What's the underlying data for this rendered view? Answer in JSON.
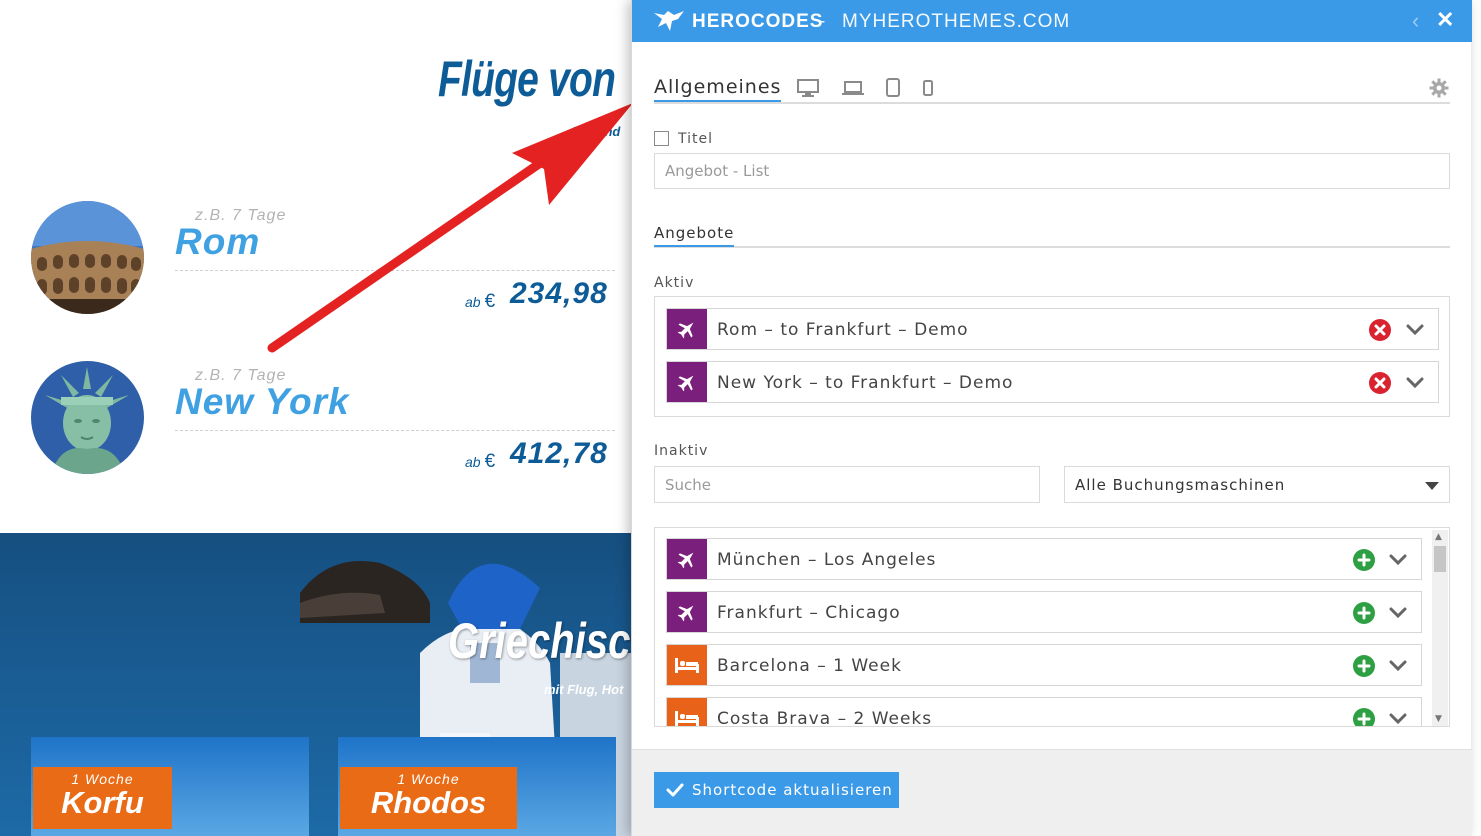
{
  "background": {
    "title": "Flüge von",
    "subtitle": "Hin und",
    "offers": [
      {
        "duration": "z.B. 7 Tage",
        "city": "Rom",
        "price_prefix": "ab",
        "currency": "€",
        "price": "234,98"
      },
      {
        "duration": "z.B. 7 Tage",
        "city": "New York",
        "price_prefix": "ab",
        "currency": "€",
        "price": "412,78"
      }
    ],
    "banner_title": "Griechisc",
    "banner_subtitle": "mit Flug, Hot",
    "tiles": [
      {
        "weeks": "1 Woche",
        "name": "Korfu"
      },
      {
        "weeks": "1 Woche",
        "name": "Rhodos"
      }
    ]
  },
  "panel": {
    "brand": "HEROCODES",
    "separator": "-",
    "domain": "MYHEROTHEMES.COM",
    "collapse_icon": "chevron-left-icon",
    "close_icon": "close-icon",
    "tabs": {
      "active": "Allgemeines",
      "devices": [
        "desktop-icon",
        "laptop-icon",
        "tablet-icon",
        "phone-icon"
      ],
      "settings_icon": "gear-icon"
    },
    "title_checkbox_label": "Titel",
    "title_input_placeholder": "Angebot - List",
    "offers_section": "Angebote",
    "active_label": "Aktiv",
    "active_items": [
      {
        "label": "Rom – to Frankfurt – Demo",
        "type": "flight",
        "color": "#7b1f7d"
      },
      {
        "label": "New York – to Frankfurt – Demo",
        "type": "flight",
        "color": "#7b1f7d"
      }
    ],
    "inactive_label": "Inaktiv",
    "search_placeholder": "Suche",
    "engine_select": "Alle Buchungsmaschinen",
    "inactive_items": [
      {
        "label": "München – Los Angeles",
        "type": "flight",
        "color": "#7b1f7d"
      },
      {
        "label": "Frankfurt – Chicago",
        "type": "flight",
        "color": "#7b1f7d"
      },
      {
        "label": "Barcelona – 1 Week",
        "type": "hotel",
        "color": "#e8621a"
      },
      {
        "label": "Costa Brava – 2 Weeks",
        "type": "hotel",
        "color": "#e8621a"
      }
    ],
    "update_button": "Shortcode aktualisieren",
    "colors": {
      "accent": "#3a9ae8",
      "remove": "#d9232e",
      "add": "#2ea043"
    }
  }
}
